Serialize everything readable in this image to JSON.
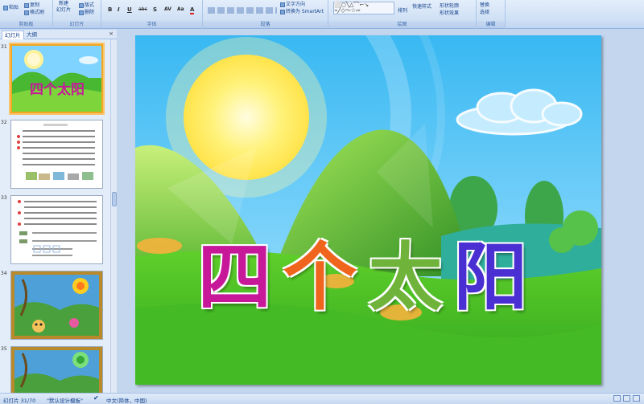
{
  "ribbon": {
    "clipboard": {
      "paste": "粘贴",
      "copy": "复制",
      "format_painter": "格式刷",
      "label": "剪贴板"
    },
    "slides": {
      "new_slide_line1": "新建",
      "new_slide_line2": "幻灯片",
      "layout": "版式",
      "delete": "删除",
      "label": "幻灯片"
    },
    "font": {
      "label": "字体",
      "bold": "B",
      "italic": "I",
      "underline": "U",
      "strike": "abc",
      "shadow": "S",
      "spacing": "AV",
      "case": "Aa",
      "color": "A"
    },
    "paragraph": {
      "label": "段落",
      "convert_smartart": "转换为 SmartArt",
      "text_direction": "文字方向"
    },
    "drawing": {
      "label": "绘图",
      "arrange": "排列",
      "quick_styles": "快速样式",
      "shape_fill": "形状轮廓",
      "shape_effects": "形状效果"
    },
    "editing": {
      "label": "编辑",
      "replace": "替换",
      "select": "选择"
    }
  },
  "panel": {
    "tabs": [
      "幻灯片",
      "大纲"
    ],
    "close": "×",
    "slides": [
      {
        "number": "31",
        "selected": true
      },
      {
        "number": "32",
        "selected": false
      },
      {
        "number": "33",
        "selected": false
      },
      {
        "number": "34",
        "selected": false
      },
      {
        "number": "35",
        "selected": false
      }
    ],
    "thumb31_title": "四个太阳"
  },
  "slide": {
    "title_chars": [
      "四",
      "个",
      "太",
      "阳"
    ],
    "title_colors": [
      "#c8189a",
      "#f0651e",
      "#6fb33b",
      "#4a2fd2"
    ]
  },
  "status": {
    "slide_info": "幻灯片 31/70",
    "theme": "\"默认设计模板\"",
    "language": "中文(简体，中国)"
  }
}
